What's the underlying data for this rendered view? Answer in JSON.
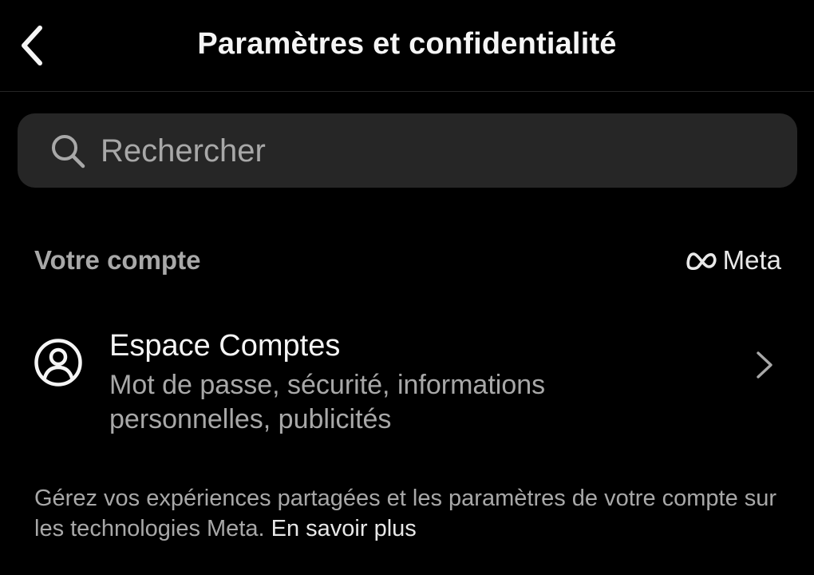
{
  "header": {
    "title": "Paramètres et confidentialité",
    "back_icon": "chevron-left-icon"
  },
  "search": {
    "placeholder": "Rechercher",
    "value": "",
    "icon": "search-icon"
  },
  "section": {
    "title": "Votre compte",
    "brand": {
      "label": "Meta",
      "icon": "meta-logo-icon"
    }
  },
  "accounts_center": {
    "icon": "user-circle-icon",
    "title": "Espace Comptes",
    "subtitle": "Mot de passe, sécurité, informations personnelles, publicités",
    "chevron_icon": "chevron-right-icon"
  },
  "footer": {
    "text": "Gérez vos expériences partagées et les paramètres de votre compte sur les technologies Meta.",
    "link_label": "En savoir plus"
  },
  "colors": {
    "background": "#000000",
    "surface": "#262626",
    "text_primary": "#f5f5f5",
    "text_secondary": "#a8a8a8"
  }
}
